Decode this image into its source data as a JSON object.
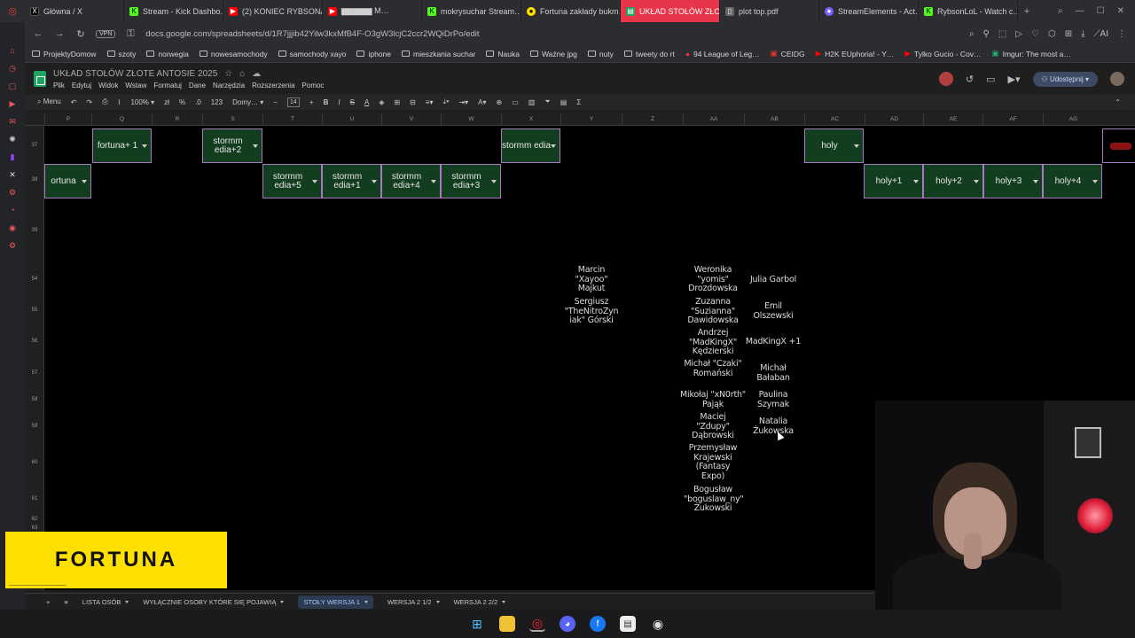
{
  "browser": {
    "tabs": [
      {
        "label": "Główna / X",
        "icon": "x-logo-icon",
        "color": "#000000"
      },
      {
        "label": "Stream - Kick Dashbo…",
        "icon": "kick-logo-icon",
        "color": "#53fc18"
      },
      {
        "label": "(2) KONIEC RYBSONA…",
        "icon": "youtube-icon",
        "color": "#ff0000"
      },
      {
        "label": "▆▆▆▆▆ M…",
        "icon": "youtube-icon",
        "color": "#ff0000"
      },
      {
        "label": "mokrysuchar Stream…",
        "icon": "kick-logo-icon",
        "color": "#53fc18"
      },
      {
        "label": "Fortuna zakłady bukm…",
        "icon": "fortuna-icon",
        "color": "#fde000"
      },
      {
        "label": "UKŁAD STOŁÓW ZŁOTE A…",
        "icon": "sheets-icon",
        "color": "#1ea362"
      },
      {
        "label": "plot top.pdf",
        "icon": "pdf-icon",
        "color": "#888888"
      },
      {
        "label": "StreamElements - Act…",
        "icon": "streamelements-icon",
        "color": "#7b61ff"
      },
      {
        "label": "RybsonLoL - Watch c…",
        "icon": "kick-logo-icon",
        "color": "#53fc18"
      }
    ],
    "url": "docs.google.com/spreadsheets/d/1R7jjjib42Yilw3kxMfB4F-O3gW3lcjC2ccr2WQiDrPo/edit",
    "vpn_label": "VPN",
    "bookmarks": [
      "ProjektyDomow",
      "szoty",
      "norwegia",
      "nowesamochody",
      "samochody xayo",
      "iphone",
      "mieszkania suchar",
      "Nauka",
      "Ważne jpg",
      "nuty",
      "tweety do rt",
      "94 League of Leg…",
      "CEIDG",
      "H2K EUphoria! - Y…",
      "Tylko Gucio - Cov…",
      "Imgur: The most a…"
    ]
  },
  "sheets": {
    "doc_title": "UKŁAD STOŁÓW ZŁOTE ANTOSIE 2025",
    "menus": [
      "Plik",
      "Edytuj",
      "Widok",
      "Wstaw",
      "Formatuj",
      "Dane",
      "Narzędzia",
      "Rozszerzenia",
      "Pomoc"
    ],
    "share_label": "Udostępnij",
    "toolbar": {
      "menu_label": "Menu",
      "zoom": "100%",
      "percent": "%",
      "decimals": ".0",
      "num_format": "123",
      "font": "Domy…",
      "font_size": "14"
    },
    "columns": [
      "P",
      "Q",
      "R",
      "S",
      "T",
      "U",
      "V",
      "W",
      "X",
      "Y",
      "Z",
      "AA",
      "AB",
      "AC",
      "AD",
      "AE",
      "AF",
      "AG"
    ],
    "rows": [
      "37",
      "38",
      "39",
      "54",
      "55",
      "56",
      "57",
      "58",
      "59",
      "60",
      "61",
      "62",
      "63"
    ],
    "chips": [
      {
        "label": "fortuna+ 1"
      },
      {
        "label": "stormm edia+2"
      },
      {
        "label": "stormm edia"
      },
      {
        "label": "holy"
      },
      {
        "label": "ortuna"
      },
      {
        "label": "stormm edia+5"
      },
      {
        "label": "stormm edia+1"
      },
      {
        "label": "stormm edia+4"
      },
      {
        "label": "stormm edia+3"
      },
      {
        "label": "holy+1"
      },
      {
        "label": "holy+2"
      },
      {
        "label": "holy+3"
      },
      {
        "label": "holy+4"
      }
    ],
    "names_col_y": [
      "Marcin \"Xayoo\" Majkut",
      "Sergiusz \"TheNitroZyn iak\" Górski"
    ],
    "names_col_aa": [
      "Weronika \"yomis\" Drozdowska",
      "Zuzanna \"Suzianna\" Dawidowska",
      "Andrzej \"MadKingX\" Kędzierski",
      "Michał \"Czaki\" Romański",
      "Mikołaj \"xN0rth\" Pająk",
      "Maciej \"Zdupy\" Dąbrowski",
      "Przemysław Krajewski (Fantasy Expo)",
      "Bogusław \"boguslaw_ny\" Żukowski"
    ],
    "names_col_ab": [
      "Julia Garbol",
      "Emil Olszewski",
      "MadKingX +1",
      "Michał Bałaban",
      "Paulina Szymak",
      "Natalia Żukowska"
    ],
    "sheet_tabs": [
      {
        "label": "LISTA OSÓB"
      },
      {
        "label": "WYŁĄCZNIE OSOBY KTÓRE SIĘ POJAWIĄ"
      },
      {
        "label": "STOŁY WERSJA 1",
        "active": true
      },
      {
        "label": "WERSJA 2 1/2"
      },
      {
        "label": "WERSJA 2 2/2"
      }
    ]
  },
  "overlay": {
    "fortuna_logo": "FORTUNA"
  }
}
